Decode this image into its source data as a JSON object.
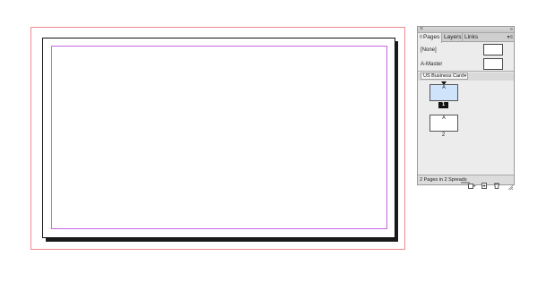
{
  "panel": {
    "tabs": [
      {
        "label": "Pages",
        "active": true
      },
      {
        "label": "Layers",
        "active": false
      },
      {
        "label": "Links",
        "active": false
      }
    ],
    "menu_icon": "panel-menu-icon",
    "masters": [
      {
        "label": "[None]"
      },
      {
        "label": "A-Master"
      }
    ],
    "page_size": "US Business Card",
    "pages": [
      {
        "number": "1",
        "master": "A",
        "selected": true
      },
      {
        "number": "2",
        "master": "A",
        "selected": false
      }
    ],
    "status": "2 Pages in 2 Spreads"
  },
  "colors": {
    "bleed_guide": "#f28b92",
    "margin_guide": "#c468e0",
    "selected_page": "#cfe3fb",
    "panel_bg": "#ececec"
  }
}
